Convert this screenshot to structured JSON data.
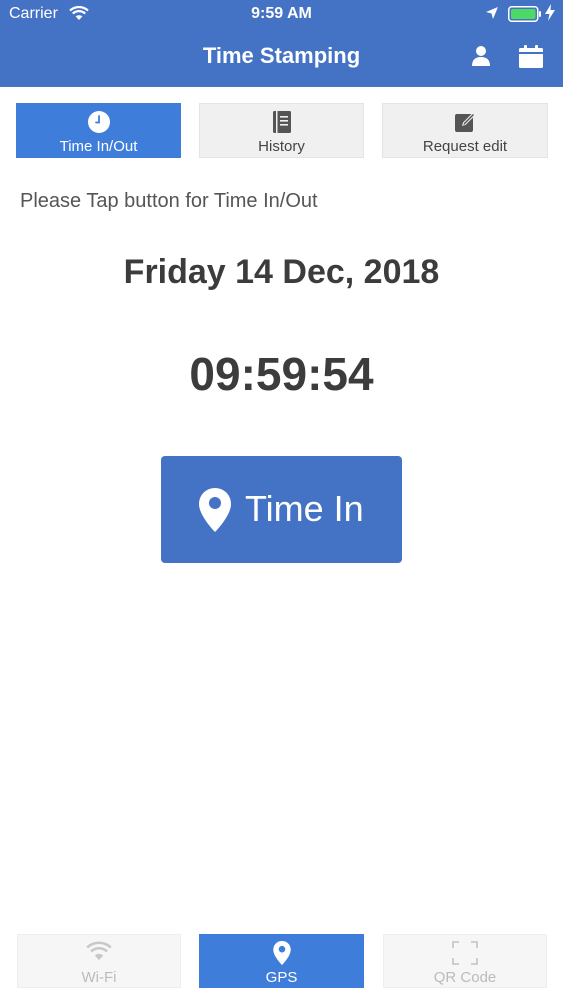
{
  "status_bar": {
    "carrier": "Carrier",
    "time": "9:59 AM",
    "battery_color": "#4cd964"
  },
  "header": {
    "title": "Time Stamping",
    "background": "#4472c4",
    "icons": [
      "user-icon",
      "calendar-icon"
    ]
  },
  "tabs": [
    {
      "label": "Time In/Out",
      "icon": "clock-icon",
      "active": true
    },
    {
      "label": "History",
      "icon": "book-icon",
      "active": false
    },
    {
      "label": "Request edit",
      "icon": "edit-icon",
      "active": false
    }
  ],
  "main": {
    "instruction": "Please Tap button for Time In/Out",
    "date": "Friday 14 Dec, 2018",
    "clock": "09:59:54",
    "button_label": "Time In",
    "accent": "#3f7ddb"
  },
  "bottom_tabs": [
    {
      "label": "Wi-Fi",
      "icon": "wifi-icon",
      "active": false
    },
    {
      "label": "GPS",
      "icon": "map-pin-icon",
      "active": true
    },
    {
      "label": "QR Code",
      "icon": "qr-scan-icon",
      "active": false
    }
  ]
}
